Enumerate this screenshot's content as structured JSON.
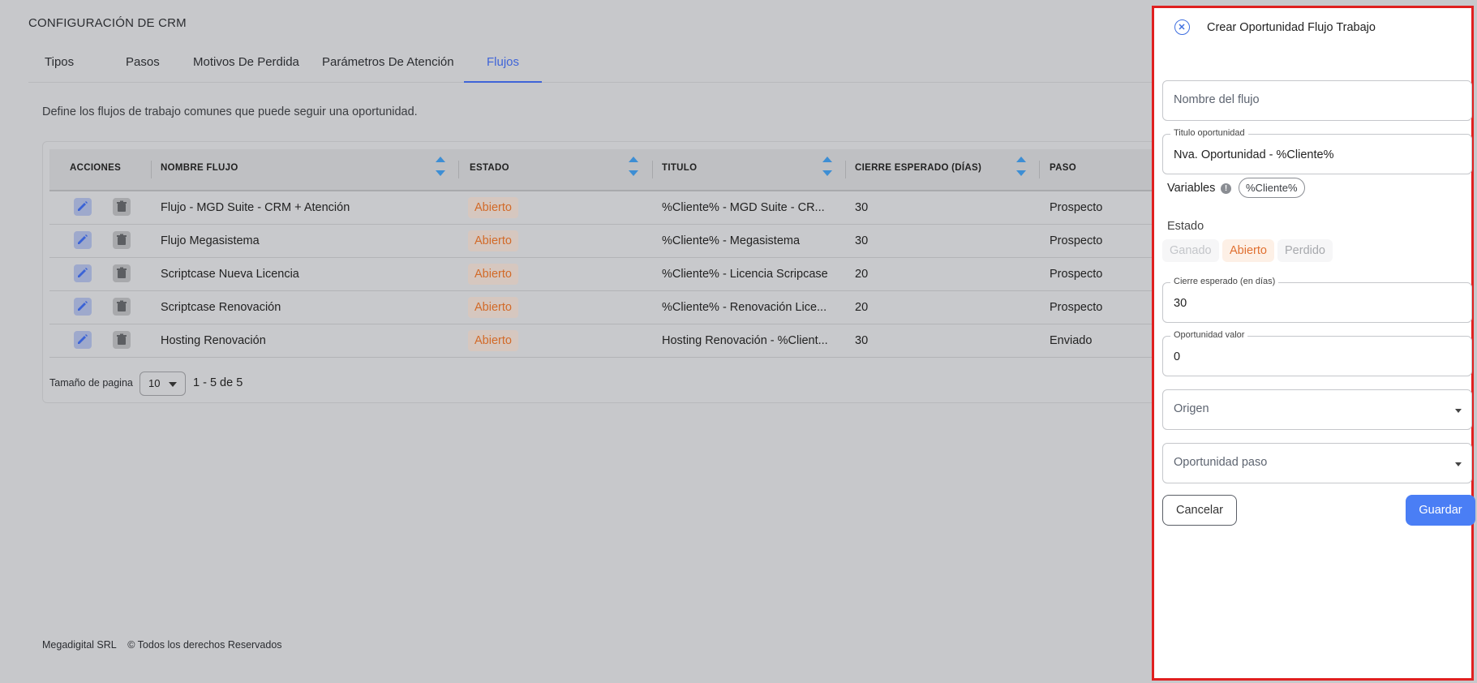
{
  "page": {
    "title": "CONFIGURACIÓN DE CRM",
    "tabs": [
      {
        "label": "Tipos"
      },
      {
        "label": "Pasos"
      },
      {
        "label": "Motivos De Perdida"
      },
      {
        "label": "Parámetros De Atención"
      },
      {
        "label": "Flujos"
      }
    ],
    "active_tab": "Flujos",
    "description": "Define los flujos de trabajo comunes que puede seguir una oportunidad."
  },
  "table": {
    "headers": {
      "acciones": "ACCIONES",
      "nombre": "NOMBRE FLUJO",
      "estado": "ESTADO",
      "titulo": "TITULO",
      "cierre": "CIERRE ESPERADO (DÍAS)",
      "paso": "PASO"
    },
    "rows": [
      {
        "nombre": "Flujo - MGD Suite - CRM + Atención",
        "estado": "Abierto",
        "titulo": "%Cliente% - MGD Suite - CR...",
        "cierre": "30",
        "paso": "Prospecto"
      },
      {
        "nombre": "Flujo Megasistema",
        "estado": "Abierto",
        "titulo": "%Cliente% - Megasistema",
        "cierre": "30",
        "paso": "Prospecto"
      },
      {
        "nombre": "Scriptcase Nueva Licencia",
        "estado": "Abierto",
        "titulo": "%Cliente% - Licencia Scripcase",
        "cierre": "20",
        "paso": "Prospecto"
      },
      {
        "nombre": "Scriptcase Renovación",
        "estado": "Abierto",
        "titulo": "%Cliente% - Renovación Lice...",
        "cierre": "20",
        "paso": "Prospecto"
      },
      {
        "nombre": "Hosting Renovación",
        "estado": "Abierto",
        "titulo": "Hosting Renovación - %Client...",
        "cierre": "30",
        "paso": "Enviado"
      }
    ]
  },
  "pager": {
    "label": "Tamaño de pagina",
    "page_size": "10",
    "range": "1 - 5 de 5"
  },
  "footer": {
    "company": "Megadigital SRL",
    "rights": "© Todos los derechos Reservados"
  },
  "drawer": {
    "title": "Crear Oportunidad Flujo Trabajo",
    "nombre_placeholder": "Nombre del flujo",
    "titulo_label": "Titulo oportunidad",
    "titulo_value": "Nva. Oportunidad - %Cliente%",
    "variables_label": "Variables",
    "variable_chip": "%Cliente%",
    "estado_label": "Estado",
    "estado_options": [
      "Ganado",
      "Abierto",
      "Perdido"
    ],
    "estado_selected": "Abierto",
    "cierre_label": "Cierre esperado (en días)",
    "cierre_value": "30",
    "valor_label": "Oportunidad valor",
    "valor_value": "0",
    "origen_placeholder": "Origen",
    "paso_placeholder": "Oportunidad paso",
    "cancel_label": "Cancelar",
    "save_label": "Guardar"
  },
  "colors": {
    "accent": "#4a7ef5",
    "active_tab": "#3f64d8",
    "badge_text": "#e07030",
    "drawer_border": "#e02020"
  },
  "icons": {
    "edit": "pencil-icon",
    "delete": "trash-icon",
    "close": "close-circle-icon",
    "info": "info-icon",
    "sort": "sort-icon",
    "caret": "chevron-down-icon"
  }
}
